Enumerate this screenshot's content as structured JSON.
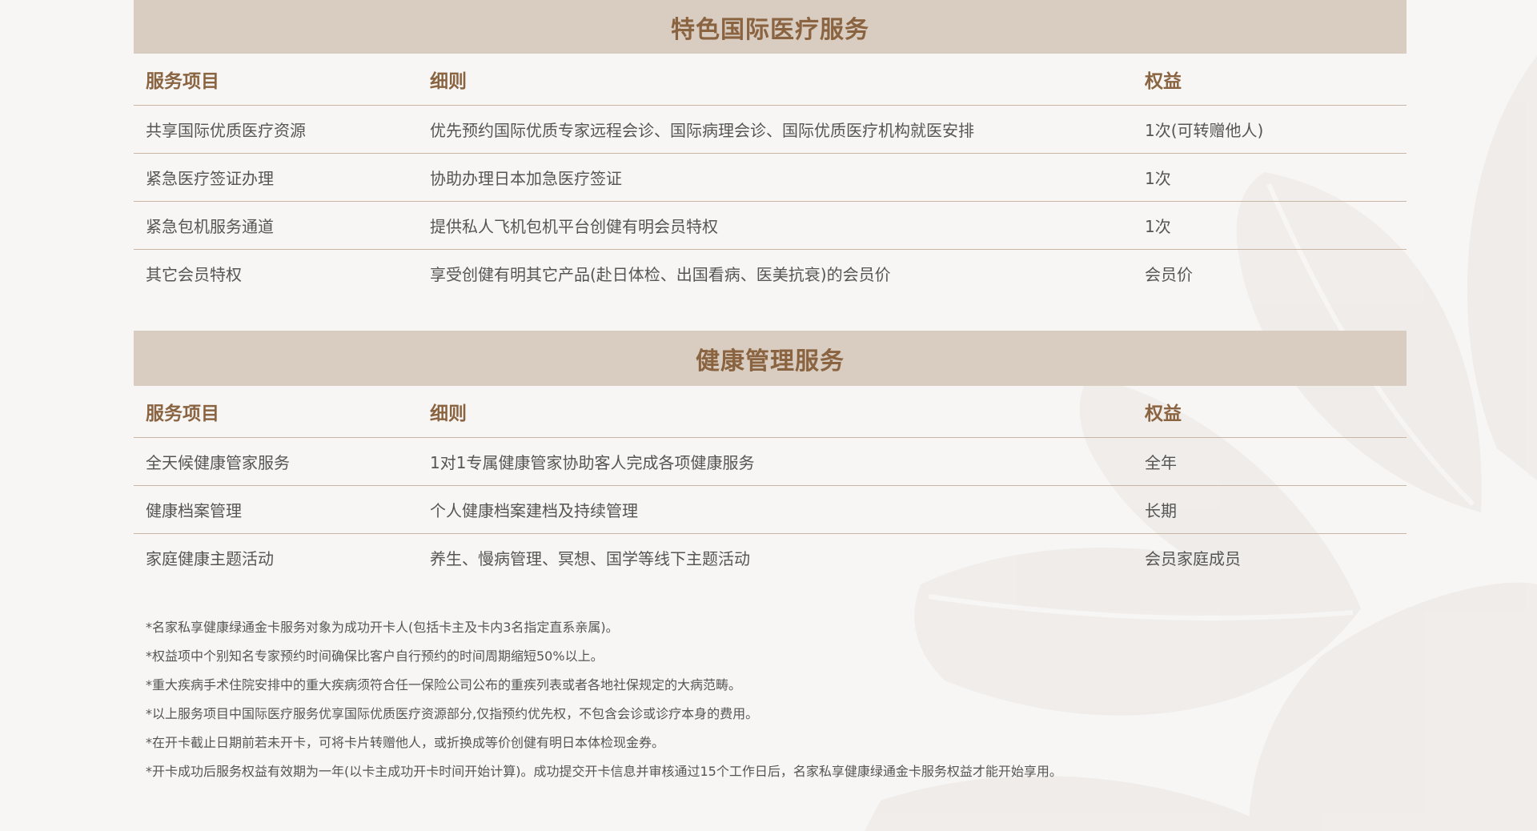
{
  "colors": {
    "banner_bg": "#d9ccc1",
    "heading": "#8a6441",
    "text": "#555555",
    "rule": "#c9b5a4",
    "page_bg": "#f7f6f5"
  },
  "sections": [
    {
      "title": "特色国际医疗服务",
      "headers": {
        "item": "服务项目",
        "detail": "细则",
        "benefit": "权益"
      },
      "rows": [
        {
          "item": "共享国际优质医疗资源",
          "detail": "优先预约国际优质专家远程会诊、国际病理会诊、国际优质医疗机构就医安排",
          "benefit": "1次(可转赠他人)"
        },
        {
          "item": "紧急医疗签证办理",
          "detail": "协助办理日本加急医疗签证",
          "benefit": "1次"
        },
        {
          "item": "紧急包机服务通道",
          "detail": "提供私人飞机包机平台创健有明会员特权",
          "benefit": "1次"
        },
        {
          "item": "其它会员特权",
          "detail": "享受创健有明其它产品(赴日体检、出国看病、医美抗衰)的会员价",
          "benefit": "会员价"
        }
      ]
    },
    {
      "title": "健康管理服务",
      "headers": {
        "item": "服务项目",
        "detail": "细则",
        "benefit": "权益"
      },
      "rows": [
        {
          "item": "全天候健康管家服务",
          "detail": "1对1专属健康管家协助客人完成各项健康服务",
          "benefit": "全年"
        },
        {
          "item": "健康档案管理",
          "detail": "个人健康档案建档及持续管理",
          "benefit": "长期"
        },
        {
          "item": "家庭健康主题活动",
          "detail": "养生、慢病管理、冥想、国学等线下主题活动",
          "benefit": "会员家庭成员"
        }
      ]
    }
  ],
  "notes": [
    "*名家私享健康绿通金卡服务对象为成功开卡人(包括卡主及卡内3名指定直系亲属)。",
    "*权益项中个别知名专家预约时间确保比客户自行预约的时间周期缩短50%以上。",
    "*重大疾病手术住院安排中的重大疾病须符合任一保险公司公布的重疾列表或者各地社保规定的大病范畴。",
    "*以上服务项目中国际医疗服务优享国际优质医疗资源部分,仅指预约优先权，不包含会诊或诊疗本身的费用。",
    "*在开卡截止日期前若未开卡，可将卡片转赠他人，或折换成等价创健有明日本体检现金券。",
    "*开卡成功后服务权益有效期为一年(以卡主成功开卡时间开始计算)。成功提交开卡信息并审核通过15个工作日后，名家私享健康绿通金卡服务权益才能开始享用。"
  ]
}
